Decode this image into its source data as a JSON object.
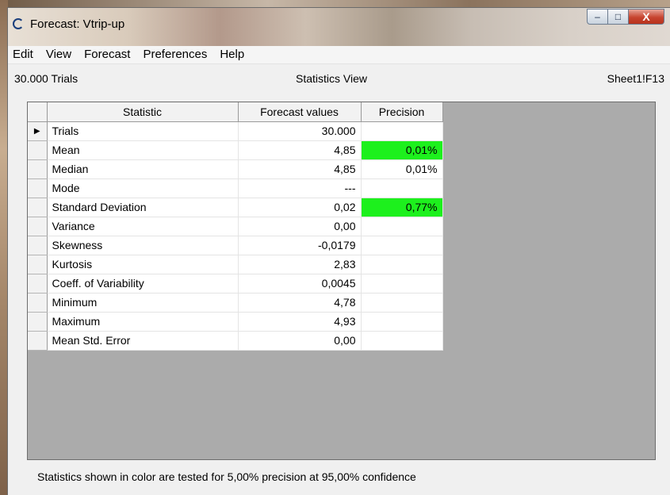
{
  "window": {
    "title": "Forecast: Vtrip-up",
    "icon": "app-ring-icon",
    "controls": {
      "minimize": "–",
      "maximize": "□",
      "close": "X"
    }
  },
  "menu": [
    "Edit",
    "View",
    "Forecast",
    "Preferences",
    "Help"
  ],
  "infobar": {
    "trials": "30.000 Trials",
    "view": "Statistics View",
    "cell_ref": "Sheet1!F13"
  },
  "table": {
    "columns": [
      "Statistic",
      "Forecast values",
      "Precision"
    ],
    "current_row_marker": "▶",
    "highlight_color": "#1df01d",
    "rows": [
      {
        "statistic": "Trials",
        "value": "30.000",
        "precision": "",
        "highlight": false
      },
      {
        "statistic": "Mean",
        "value": "4,85",
        "precision": "0,01%",
        "highlight": true
      },
      {
        "statistic": "Median",
        "value": "4,85",
        "precision": "0,01%",
        "highlight": false
      },
      {
        "statistic": "Mode",
        "value": "---",
        "precision": "",
        "highlight": false
      },
      {
        "statistic": "Standard Deviation",
        "value": "0,02",
        "precision": "0,77%",
        "highlight": true
      },
      {
        "statistic": "Variance",
        "value": "0,00",
        "precision": "",
        "highlight": false
      },
      {
        "statistic": "Skewness",
        "value": "-0,0179",
        "precision": "",
        "highlight": false
      },
      {
        "statistic": "Kurtosis",
        "value": "2,83",
        "precision": "",
        "highlight": false
      },
      {
        "statistic": "Coeff. of Variability",
        "value": "0,0045",
        "precision": "",
        "highlight": false
      },
      {
        "statistic": "Minimum",
        "value": "4,78",
        "precision": "",
        "highlight": false
      },
      {
        "statistic": "Maximum",
        "value": "4,93",
        "precision": "",
        "highlight": false
      },
      {
        "statistic": "Mean Std. Error",
        "value": "0,00",
        "precision": "",
        "highlight": false
      }
    ]
  },
  "footnote": "Statistics shown in color are tested for 5,00% precision at 95,00% confidence"
}
